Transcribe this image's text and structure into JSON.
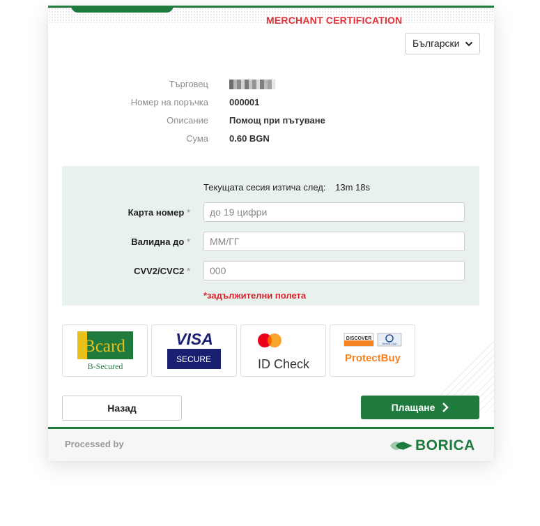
{
  "header": {
    "title": "MERCHANT CERTIFICATION",
    "language": "Български"
  },
  "order": {
    "merchant_label": "Търговец",
    "order_number_label": "Номер на поръчка",
    "order_number": "000001",
    "description_label": "Описание",
    "description": "Помощ при пътуване",
    "amount_label": "Сума",
    "amount": "0.60 BGN"
  },
  "form": {
    "session_label": "Текущата сесия изтича след:",
    "session_timer": "13m 18s",
    "card_number_label": "Карта номер",
    "card_number_placeholder": "до 19 цифри",
    "expiry_label": "Валидна до",
    "expiry_placeholder": "ММ/ГГ",
    "cvv_label": "CVV2/CVC2",
    "cvv_placeholder": "000",
    "required_marker": "*",
    "required_note": "*задължителни полета"
  },
  "security_logos": {
    "bcard_text": "Bcard",
    "bcard_sub": "B-Secured",
    "visa_text": "VISA",
    "visa_sub": "SECURE",
    "mastercard_text": "ID Check",
    "discover_text": "ProtectBuy",
    "discover_small": "DISCOVER",
    "diners_small": "Diners Club"
  },
  "actions": {
    "back_label": "Назад",
    "pay_label": "Плащане"
  },
  "footer": {
    "processed_by": "Processed by",
    "brand": "BORICA"
  },
  "colors": {
    "brand_green": "#1f7a3e",
    "title_red": "#e0323a",
    "panel_bg": "#e8f1ec"
  }
}
